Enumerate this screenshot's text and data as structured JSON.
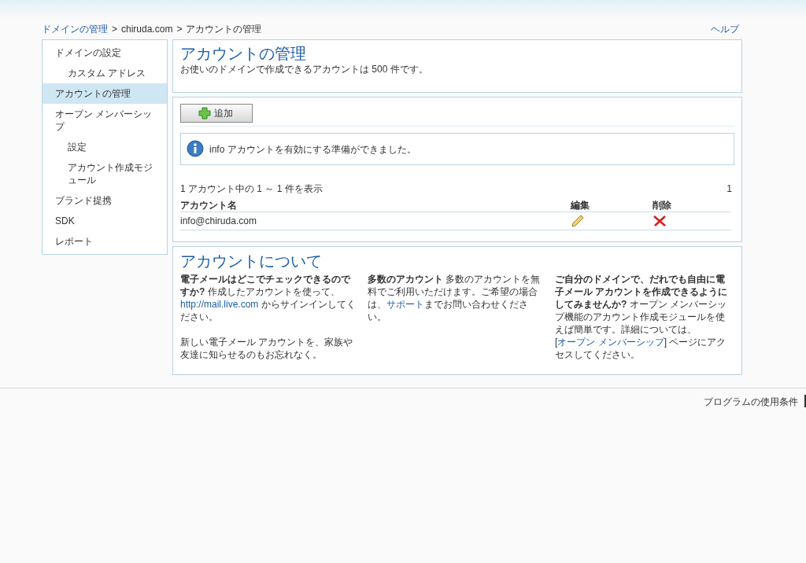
{
  "breadcrumb": [
    {
      "label": "ドメインの管理",
      "kind": "link"
    },
    {
      "label": "chiruda.com",
      "kind": "text"
    },
    {
      "label": "アカウントの管理",
      "kind": "text"
    }
  ],
  "breadcrumb_separator": ">",
  "help_link": "ヘルプ",
  "sidebar": {
    "items": [
      {
        "label": "ドメインの設定",
        "selected": false,
        "children": [
          {
            "label": "カスタム アドレス",
            "selected": false
          }
        ]
      },
      {
        "label": "アカウントの管理",
        "selected": true
      },
      {
        "label": "オープン メンバーシップ",
        "selected": false,
        "children": [
          {
            "label": "設定",
            "selected": false
          },
          {
            "label": "アカウント作成モジュール",
            "selected": false
          }
        ]
      },
      {
        "label": "ブランド提携",
        "selected": false
      },
      {
        "label": "SDK",
        "selected": false
      },
      {
        "label": "レポート",
        "selected": false
      }
    ]
  },
  "header": {
    "title": "アカウントの管理",
    "subtitle": "お使いのドメインで作成できるアカウントは 500 件です。"
  },
  "add_button": "追加",
  "info_message": "info アカウントを有効にする準備ができました。",
  "paging": {
    "summary": "1 アカウント中の 1 ～ 1 件を表示",
    "page": "1"
  },
  "table": {
    "columns": [
      "アカウント名",
      "編集",
      "削除"
    ],
    "rows": [
      {
        "name": "info@chiruda.com"
      }
    ]
  },
  "about": {
    "title": "アカウントについて",
    "columns": [
      {
        "paragraphs": [
          [
            {
              "kind": "bold",
              "text": "電子メールはどこでチェックできるのですか?"
            },
            {
              "kind": "plain",
              "text": " 作成したアカウントを使って、"
            },
            {
              "kind": "link",
              "text": "http://mail.live.com"
            },
            {
              "kind": "plain",
              "text": " からサインインしてください。"
            }
          ],
          [
            {
              "kind": "plain",
              "text": "新しい電子メール アカウントを、家族や友達に知らせるのもお忘れなく。"
            }
          ]
        ]
      },
      {
        "paragraphs": [
          [
            {
              "kind": "bold",
              "text": "多数のアカウント"
            },
            {
              "kind": "plain",
              "text": " 多数のアカウントを無料でご利用いただけます。ご希望の場合は、"
            },
            {
              "kind": "link",
              "text": "サポート"
            },
            {
              "kind": "plain",
              "text": "までお問い合わせください。"
            }
          ]
        ]
      },
      {
        "paragraphs": [
          [
            {
              "kind": "bold",
              "text": "ご自分のドメインで、だれでも自由に電子メール アカウントを作成できるようにしてみませんか?"
            },
            {
              "kind": "plain",
              "text": " オープン メンバーシップ機能のアカウント作成モジュールを使えば簡単です。詳細については、["
            },
            {
              "kind": "link",
              "text": "オープン メンバーシップ"
            },
            {
              "kind": "plain",
              "text": "] ページにアクセスしてください。"
            }
          ]
        ]
      }
    ]
  },
  "footer": {
    "link": "プログラムの使用条件"
  }
}
